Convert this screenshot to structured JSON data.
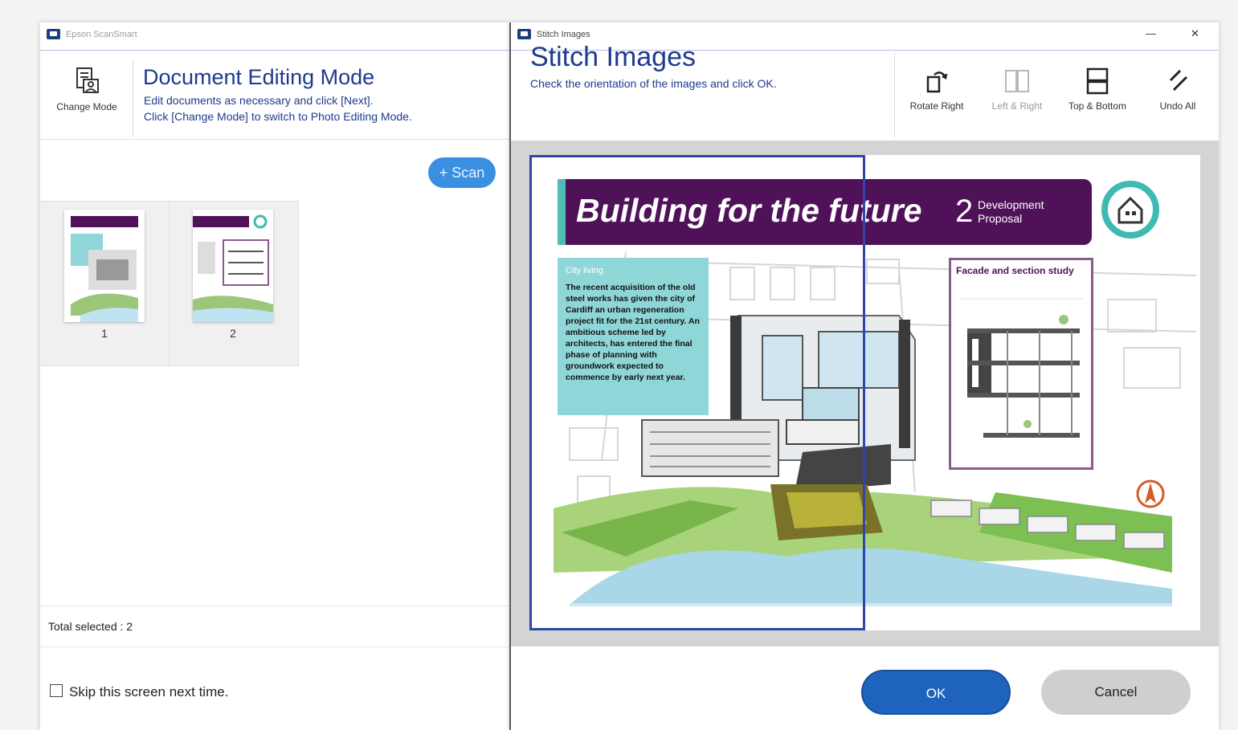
{
  "left_window": {
    "title": "Epson ScanSmart",
    "change_mode_label": "Change Mode",
    "title_heading": "Document Editing Mode",
    "subtitle_line1": "Edit documents as necessary and click [Next].",
    "subtitle_line2": "Click [Change Mode] to switch to Photo Editing Mode.",
    "scan_button_label": "+ Scan",
    "thumbnails": [
      {
        "page_number": "1"
      },
      {
        "page_number": "2"
      }
    ],
    "total_selected": "Total selected : 2",
    "skip_label": "Skip this screen next time."
  },
  "right_window": {
    "title": "Stitch Images",
    "heading": "Stitch Images",
    "subtitle": "Check the orientation of the images and click OK.",
    "minimize_icon": "—",
    "close_icon": "✕",
    "toolbar": {
      "rotate_right": "Rotate Right",
      "left_right": "Left & Right",
      "top_bottom": "Top & Bottom",
      "undo_all": "Undo All"
    },
    "ok_label": "OK",
    "cancel_label": "Cancel"
  },
  "preview": {
    "banner_title": "Building for the future",
    "banner_number": "2",
    "banner_sub_line1": "Development",
    "banner_sub_line2": "Proposal",
    "info_heading": "City living",
    "info_text": "The recent acquisition of the old steel works has given the city of Cardiff an urban regeneration project fit for the 21st century. An ambitious scheme led by architects, has entered the final phase of planning with groundwork expected to commence by early next year.",
    "facade_title": "Facade and section study",
    "colors": {
      "banner": "#4f1259",
      "teal": "#4fbdb6",
      "selection": "#2e46a8",
      "ok_button": "#1e63bd"
    }
  }
}
